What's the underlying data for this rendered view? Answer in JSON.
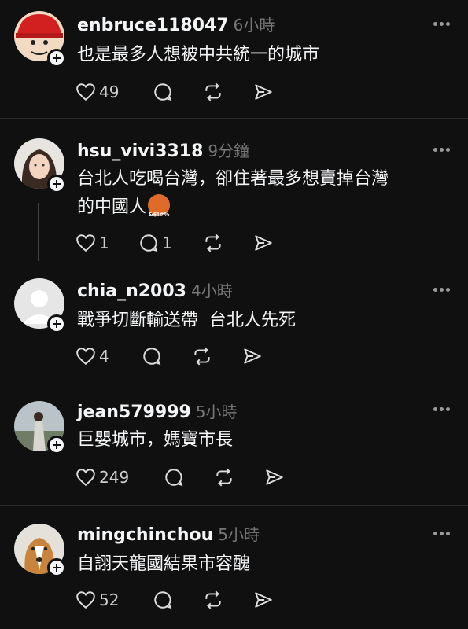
{
  "posts": [
    {
      "username": "enbruce118047",
      "time": "6小時",
      "text": "也是最多人想被中共統一的城市",
      "likes": "49",
      "replies": ""
    },
    {
      "username": "hsu_vivi3318",
      "time": "9分鐘",
      "text": "台北人吃喝台灣，卻住著最多想賣掉台灣\n的中國人",
      "likes": "1",
      "replies": "1"
    },
    {
      "username": "chia_n2003",
      "time": "4小時",
      "text": "戰爭切斷輸送帶  台北人先死",
      "likes": "4",
      "replies": ""
    },
    {
      "username": "jean579999",
      "time": "5小時",
      "text": "巨嬰城市，媽寶市長",
      "likes": "249",
      "replies": ""
    },
    {
      "username": "mingchinchou",
      "time": "5小時",
      "text": "自詡天龍國結果市容醜",
      "likes": "52",
      "replies": ""
    }
  ],
  "colors": {
    "background": "#101010",
    "text": "#f3f5f7",
    "muted": "#777777"
  }
}
